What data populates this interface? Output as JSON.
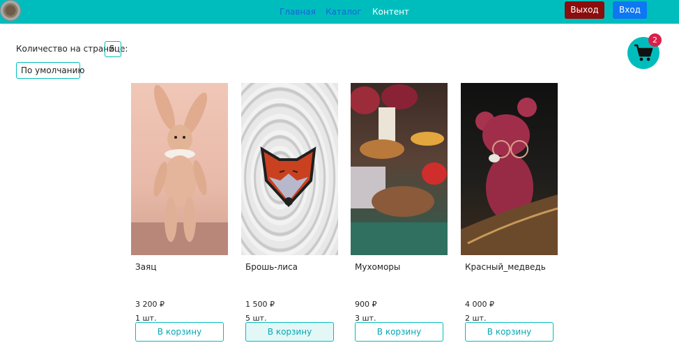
{
  "nav": {
    "links": [
      {
        "label": "Главная",
        "active": true
      },
      {
        "label": "Каталог",
        "active": true
      },
      {
        "label": "Контент",
        "active": false
      }
    ],
    "logout_label": "Выход",
    "login_label": "Вход"
  },
  "controls": {
    "per_page_label": "Количество на странице:",
    "per_page_value": "5",
    "sort_value": "По умолчанию"
  },
  "cart": {
    "count": "2",
    "icon": "shopping-cart-icon"
  },
  "products": [
    {
      "name": "Заяц",
      "price": "3 200 ₽",
      "qty": "1 шт.",
      "button": "В корзину"
    },
    {
      "name": "Брошь-лиса",
      "price": "1 500 ₽",
      "qty": "5 шт.",
      "button": "В корзину"
    },
    {
      "name": "Мухоморы",
      "price": "900 ₽",
      "qty": "3 шт.",
      "button": "В корзину"
    },
    {
      "name": "Красный_медведь",
      "price": "4 000 ₽",
      "qty": "2 шт.",
      "button": "В корзину"
    }
  ],
  "colors": {
    "accent": "#00bdbd",
    "logout": "#8b0d0d",
    "login": "#0d78f2",
    "badge": "#dc1f4a"
  }
}
